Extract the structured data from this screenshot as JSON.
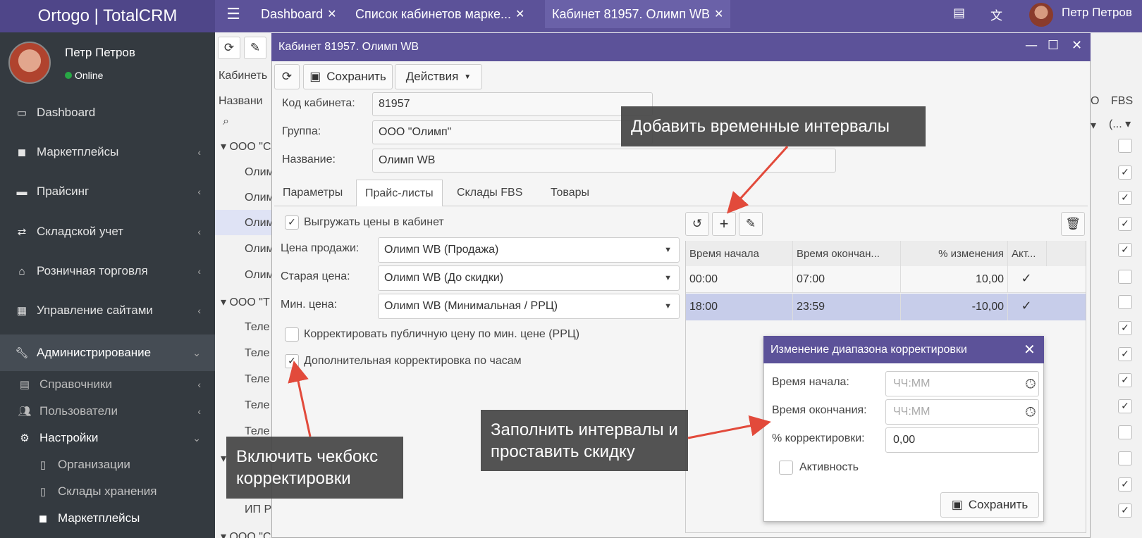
{
  "app": {
    "logo": "Ortogo | TotalCRM",
    "user": "Петр Петров"
  },
  "tabs": [
    {
      "label": "Dashboard"
    },
    {
      "label": "Список кабинетов марке..."
    },
    {
      "label": "Кабинет 81957. Олимп WB"
    }
  ],
  "sidebar": {
    "name": "Петр Петров",
    "status": "Online",
    "items": [
      {
        "label": "Dashboard"
      },
      {
        "label": "Маркетплейсы"
      },
      {
        "label": "Прайсинг"
      },
      {
        "label": "Складской учет"
      },
      {
        "label": "Розничная торговля"
      },
      {
        "label": "Управление сайтами"
      },
      {
        "label": "Администрирование"
      }
    ],
    "sub": [
      {
        "label": "Справочники"
      },
      {
        "label": "Пользователи"
      },
      {
        "label": "Настройки"
      }
    ],
    "sub2": [
      {
        "label": "Организации"
      },
      {
        "label": "Склады хранения"
      },
      {
        "label": "Маркетплейсы"
      }
    ]
  },
  "bg": {
    "label_cabinet": "Кабинеть",
    "label_name": "Названи",
    "group1": "ООО \"С",
    "group2": "ООО \"Т",
    "rows": [
      "Олим",
      "Олим",
      "Олим",
      "Олим",
      "Олим",
      "Теле",
      "Теле",
      "Теле",
      "Теле",
      "Теле"
    ],
    "row_ip": "ИП Р",
    "group3": "ООО \"С",
    "col_o": "О",
    "col_fbs": "FBS",
    "filter_fbs": "(..."
  },
  "window": {
    "title": "Кабинет 81957. Олимп WB",
    "save": "Сохранить",
    "actions": "Действия",
    "fields": {
      "code_label": "Код кабинета:",
      "code": "81957",
      "group_label": "Группа:",
      "group": "ООО \"Олимп\"",
      "name_label": "Название:",
      "name": "Олимп WB"
    },
    "tabs": [
      {
        "label": "Параметры"
      },
      {
        "label": "Прайс-листы"
      },
      {
        "label": "Склады FBS"
      },
      {
        "label": "Товары"
      }
    ],
    "export_prices": "Выгружать цены в кабинет",
    "sale_label": "Цена продажи:",
    "sale": "Олимп WB (Продажа)",
    "old_label": "Старая цена:",
    "old": "Олимп WB (До скидки)",
    "min_label": "Мин. цена:",
    "min": "Олимп WB (Минимальная / РРЦ)",
    "correct_public": "Корректировать публичную цену по мин. цене (РРЦ)",
    "hourly": "Дополнительная корректировка по часам",
    "grid": {
      "headers": [
        "Время начала",
        "Время окончан...",
        "% изменения",
        "Акт..."
      ],
      "rows": [
        {
          "start": "00:00",
          "end": "07:00",
          "pct": "10,00",
          "active": true
        },
        {
          "start": "18:00",
          "end": "23:59",
          "pct": "-10,00",
          "active": true
        }
      ]
    }
  },
  "dialog": {
    "title": "Изменение диапазона корректировки",
    "start_label": "Время начала:",
    "start_ph": "ЧЧ:ММ",
    "end_label": "Время окончания:",
    "end_ph": "ЧЧ:ММ",
    "pct_label": "% корректировки:",
    "pct": "0,00",
    "active_label": "Активность",
    "save": "Сохранить"
  },
  "callouts": {
    "add": "Добавить временные интервалы",
    "checkbox": "Включить чекбокс корректировки",
    "fill": "Заполнить интервалы и проставить скидку"
  },
  "colors": {
    "header": "#5c5299",
    "sidebar": "#343a40",
    "arrow": "#e24a3b",
    "row_selected": "#c7cdea"
  }
}
